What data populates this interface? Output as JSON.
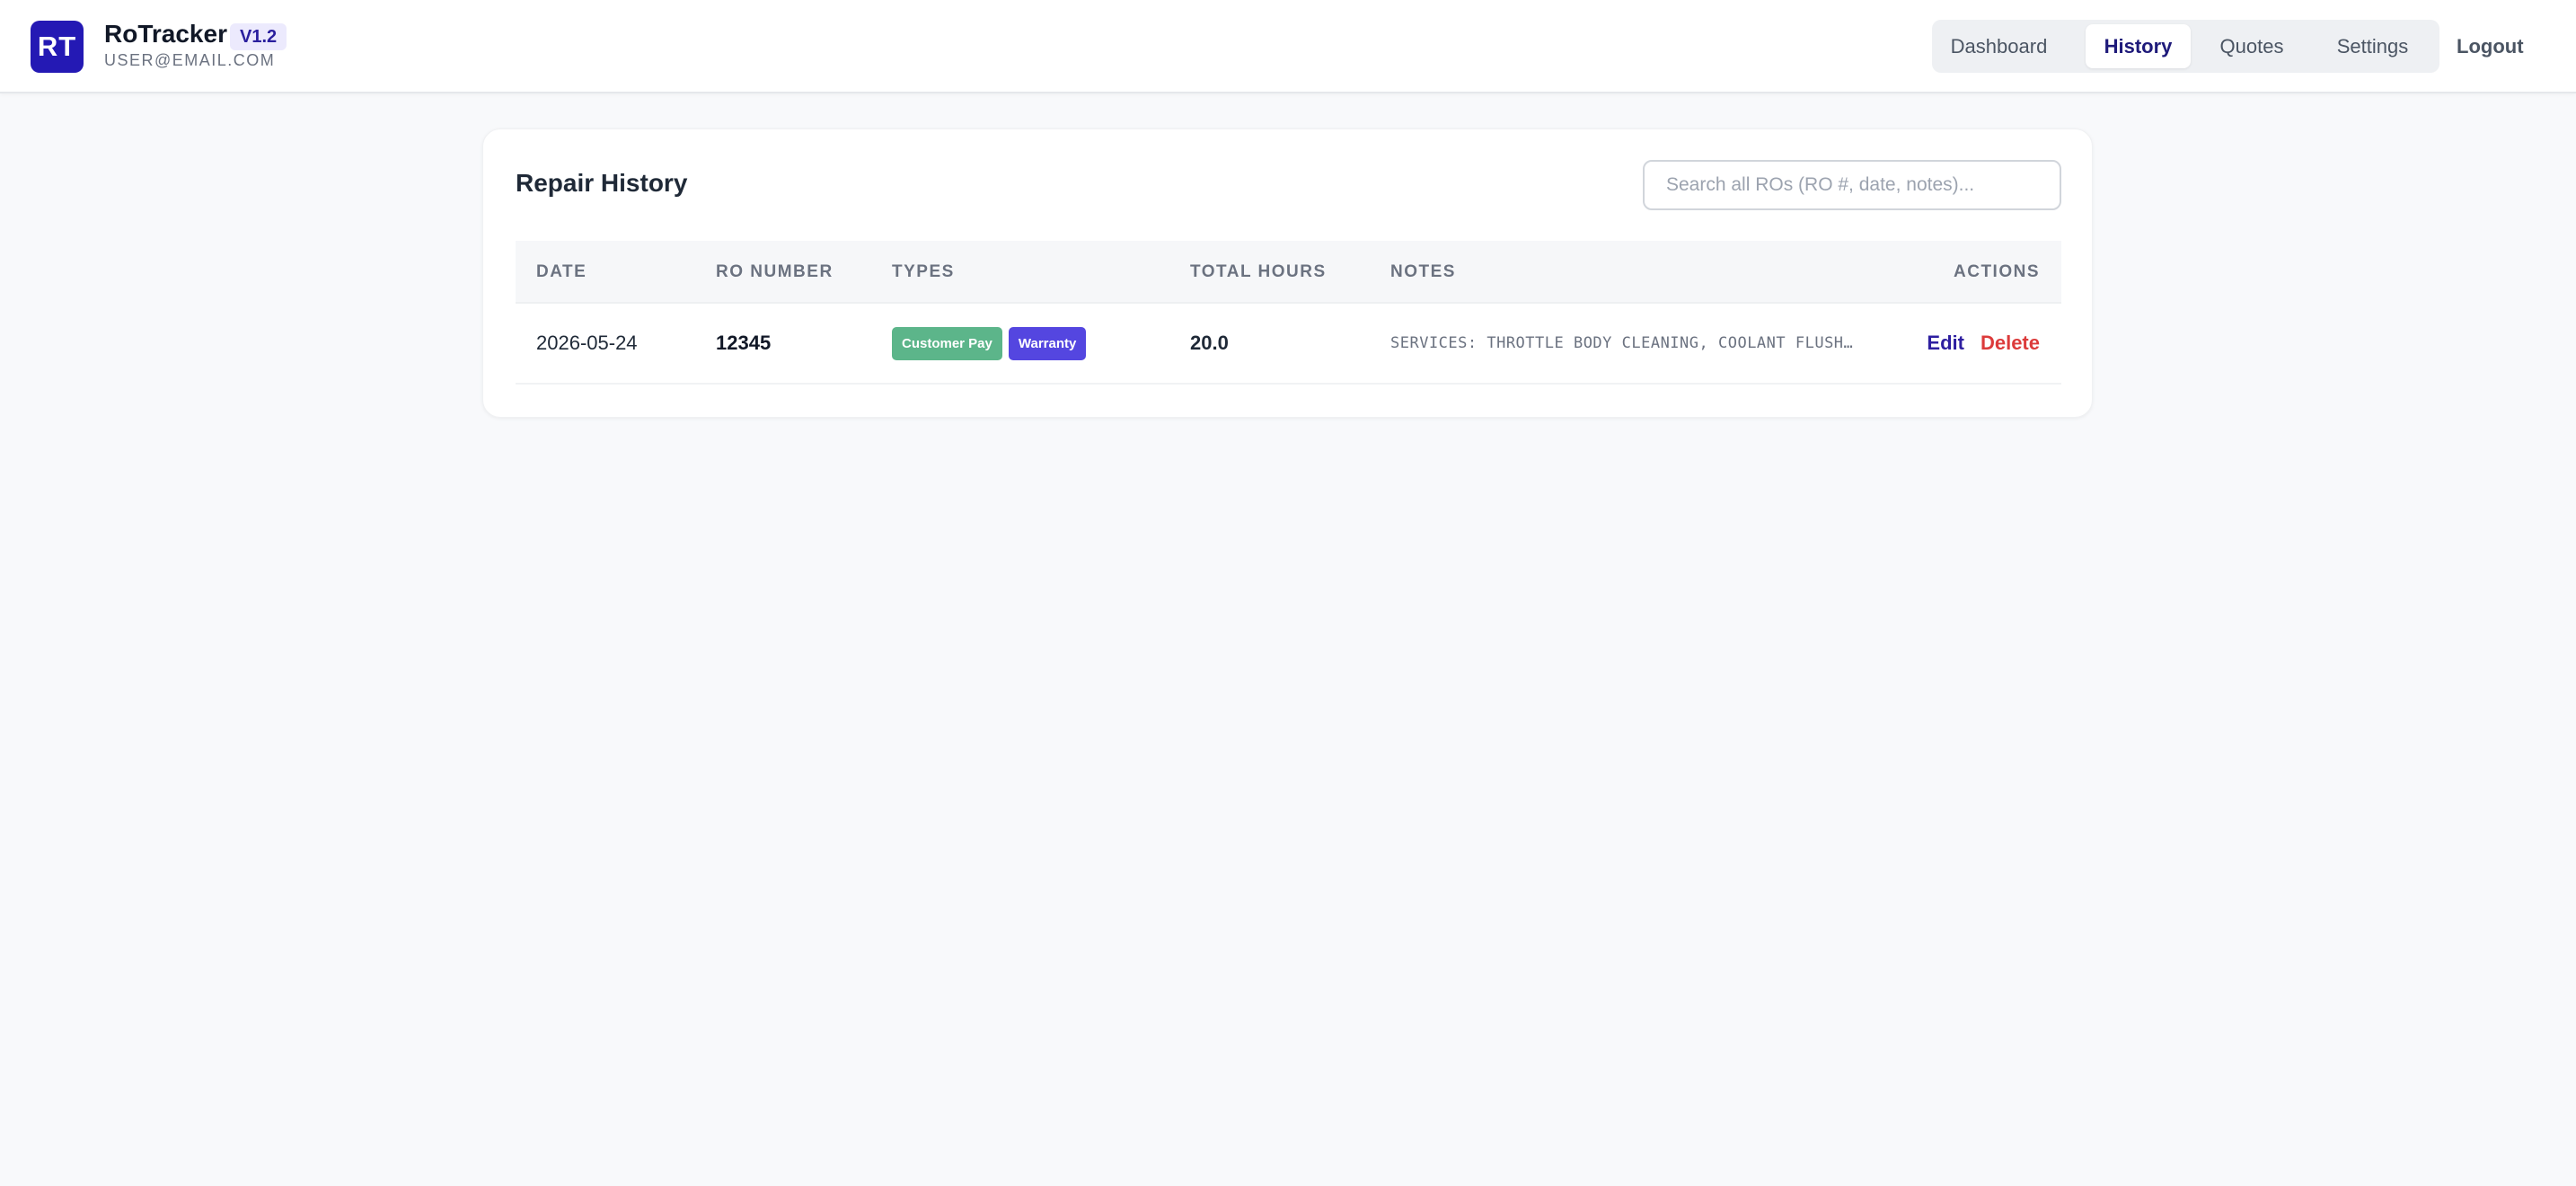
{
  "app": {
    "logo_text": "RT",
    "name": "RoTracker",
    "version": "V1.2",
    "user_email": "USER@EMAIL.COM"
  },
  "nav": {
    "items": [
      {
        "label": "Dashboard",
        "active": false
      },
      {
        "label": "History",
        "active": true
      },
      {
        "label": "Quotes",
        "active": false
      },
      {
        "label": "Settings",
        "active": false
      }
    ],
    "logout_label": "Logout"
  },
  "history": {
    "title": "Repair History",
    "search_placeholder": "Search all ROs (RO #, date, notes)...",
    "columns": [
      "DATE",
      "RO NUMBER",
      "TYPES",
      "TOTAL HOURS",
      "NOTES",
      "ACTIONS"
    ],
    "rows": [
      {
        "date": "2026-05-24",
        "ro_number": "12345",
        "types": [
          "Customer Pay",
          "Warranty"
        ],
        "total_hours": "20.0",
        "notes": "SERVICES: THROTTLE BODY CLEANING, COOLANT FLUSH…",
        "edit_label": "Edit",
        "delete_label": "Delete"
      }
    ]
  },
  "colors": {
    "brand": "#2419b4",
    "badge_customer_pay": "#5cb58a",
    "badge_warranty": "#5446e0",
    "delete": "#dc3b3b"
  }
}
